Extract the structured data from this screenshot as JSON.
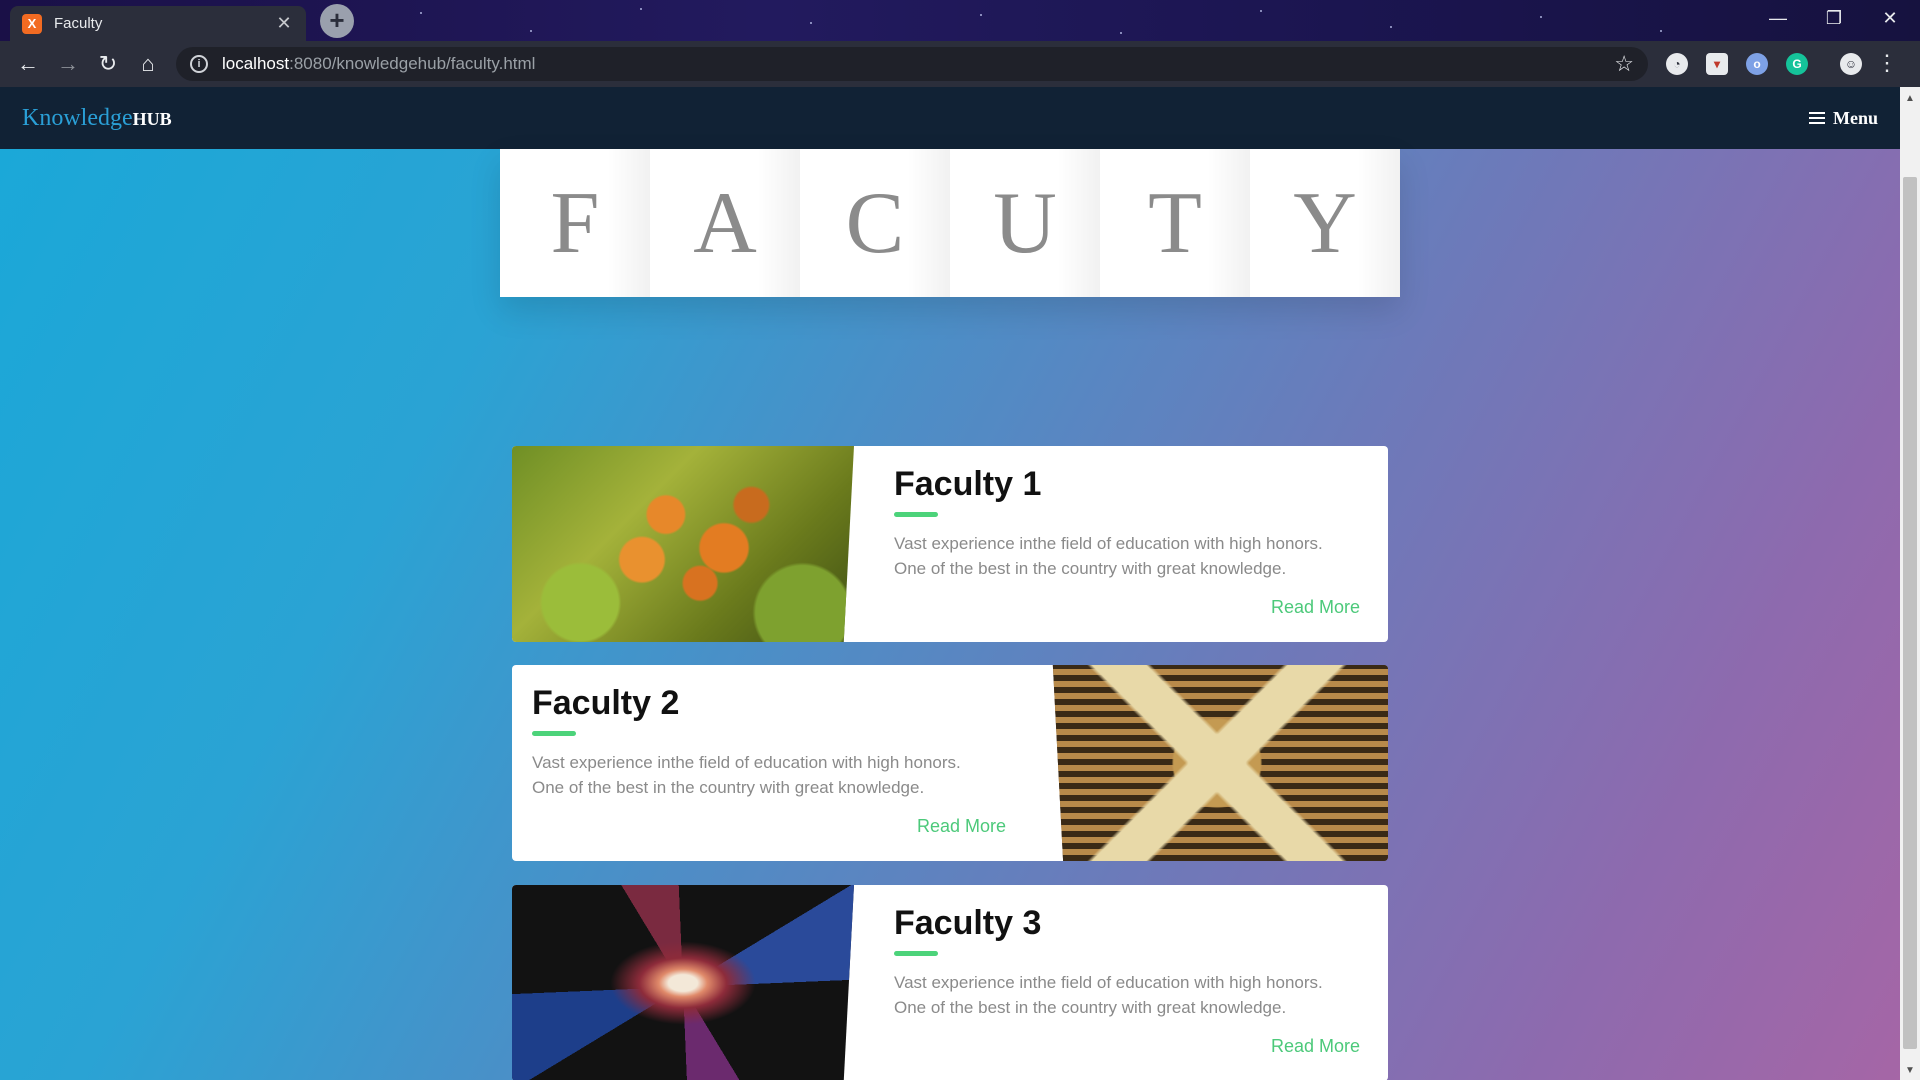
{
  "browser": {
    "tab_title": "Faculty",
    "tab_favicon": "X",
    "url_host": "localhost",
    "url_path": ":8080/knowledgehub/faculty.html"
  },
  "site": {
    "brand_part1": "Knowledge",
    "brand_part2": "HUB",
    "menu_label": "Menu",
    "title_letters": [
      "F",
      "A",
      "C",
      "U",
      "T",
      "Y"
    ]
  },
  "cards": [
    {
      "title": "Faculty 1",
      "desc_line1": "Vast experience inthe field of education with high honors.",
      "desc_line2": "One of the best in the country with great knowledge.",
      "link": "Read More"
    },
    {
      "title": "Faculty 2",
      "desc_line1": "Vast experience inthe field of education with high honors.",
      "desc_line2": "One of the best in the country with great knowledge.",
      "link": "Read More"
    },
    {
      "title": "Faculty 3",
      "desc_line1": "Vast experience inthe field of education with high honors.",
      "desc_line2": "One of the best in the country with great knowledge.",
      "link": "Read More"
    }
  ],
  "colors": {
    "accent": "#4cc97a",
    "nav_bg": "#112235",
    "brand_blue": "#2a9fd6"
  }
}
